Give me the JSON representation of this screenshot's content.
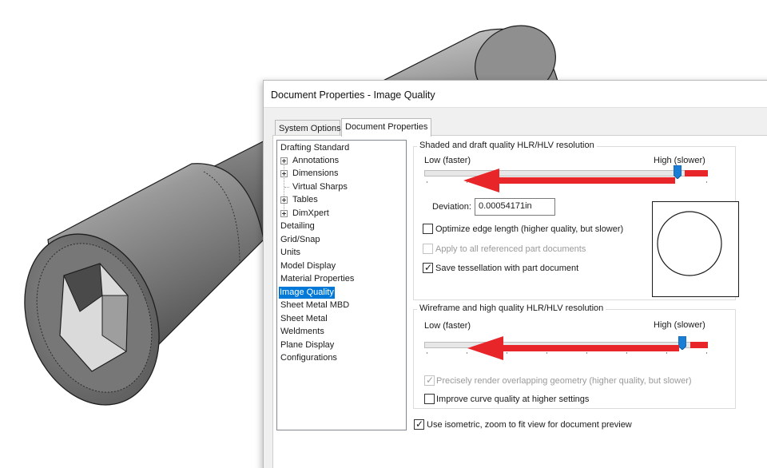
{
  "dialog": {
    "title": "Document Properties - Image Quality",
    "tabs": [
      {
        "label": "System Options",
        "active": false
      },
      {
        "label": "Document Properties",
        "active": true
      }
    ]
  },
  "tree": {
    "items": [
      {
        "label": "Drafting Standard",
        "expandable": false
      },
      {
        "label": "Annotations",
        "expandable": true
      },
      {
        "label": "Dimensions",
        "expandable": true
      },
      {
        "label": "Virtual Sharps",
        "expandable": false
      },
      {
        "label": "Tables",
        "expandable": true
      },
      {
        "label": "DimXpert",
        "expandable": true
      },
      {
        "label": "Detailing",
        "expandable": false
      },
      {
        "label": "Grid/Snap",
        "expandable": false
      },
      {
        "label": "Units",
        "expandable": false
      },
      {
        "label": "Model Display",
        "expandable": false
      },
      {
        "label": "Material Properties",
        "expandable": false
      },
      {
        "label": "Image Quality",
        "expandable": false,
        "selected": true
      },
      {
        "label": "Sheet Metal MBD",
        "expandable": false
      },
      {
        "label": "Sheet Metal",
        "expandable": false
      },
      {
        "label": "Weldments",
        "expandable": false
      },
      {
        "label": "Plane Display",
        "expandable": false
      },
      {
        "label": "Configurations",
        "expandable": false
      }
    ]
  },
  "shaded": {
    "group_label": "Shaded and draft quality HLR/HLV resolution",
    "low_label": "Low (faster)",
    "high_label": "High (slower)",
    "slider_level": 0.92,
    "deviation_label": "Deviation:",
    "deviation_value": "0.00054171in",
    "optimize_label": "Optimize edge length (higher quality, but slower)",
    "optimize_checked": false,
    "apply_label": "Apply to all referenced part documents",
    "apply_checked": false,
    "apply_disabled": true,
    "save_label": "Save tessellation with part document",
    "save_checked": true
  },
  "wireframe": {
    "group_label": "Wireframe and high quality HLR/HLV resolution",
    "low_label": "Low (faster)",
    "high_label": "High (slower)",
    "slider_level": 0.92,
    "precise_label": "Precisely render overlapping geometry (higher quality, but slower)",
    "precise_checked": true,
    "precise_disabled": true,
    "improve_label": "Improve curve quality at higher settings",
    "improve_checked": false
  },
  "isometric_label": "Use isometric, zoom to fit view for document preview",
  "isometric_checked": true,
  "colors": {
    "selection": "#0078d7",
    "arrow_red": "#e8262a",
    "slider_thumb": "#1a7fd4"
  },
  "icons": {
    "checkmark": "✓",
    "expand": "plus-box-icon"
  }
}
